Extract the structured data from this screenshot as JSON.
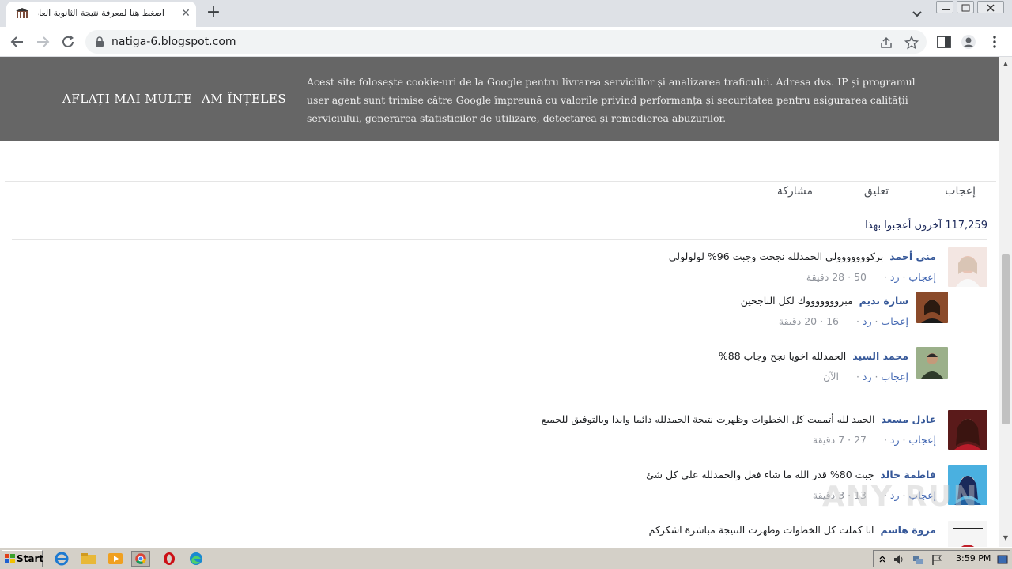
{
  "browser": {
    "tab_title": "اضغط هنا لمعرفة نتيجة الثانوية العامة",
    "tab_close": "✕",
    "new_tab": "+",
    "url": "natiga-6.blogspot.com"
  },
  "cookie_bar": {
    "learn_more": "AFLAȚI MAI MULTE",
    "understood": "AM ÎNȚELES",
    "text": "Acest site folosește cookie-uri de la Google pentru livrarea serviciilor și analizarea traficului. Adresa dvs. IP și programul user agent sunt trimise către Google împreună cu valorile privind performanța și securitatea pentru asigurarea calității serviciului, generarea statisticilor de utilizare, detectarea și remedierea abuzurilor."
  },
  "post_actions": {
    "like": "إعجاب",
    "comment": "تعليق",
    "share": "مشاركة"
  },
  "likes_summary": "117,259 آخرون أعجبوا بهذا",
  "comments": [
    {
      "name": "منى أحمد",
      "text": "بركووووووولى الحمدلله نجحت وجبت 96% لولولولى",
      "like": "إعجاب",
      "reply": "رد",
      "count": "50",
      "time": "28 دقيقة",
      "reply_level": 0
    },
    {
      "name": "سارة نديم",
      "text": "مبروووووووك لكل الناجحين",
      "like": "إعجاب",
      "reply": "رد",
      "count": "16",
      "time": "20 دقيقة",
      "reply_level": 1
    },
    {
      "name": "محمد السيد",
      "text": "الحمدلله اخويا نجح وجاب 88%",
      "like": "إعجاب",
      "reply": "رد",
      "count": "",
      "time": "الآن",
      "reply_level": 1
    },
    {
      "name": "عادل مسعد",
      "text": "الحمد لله أتممت كل الخطوات وظهرت نتيجة الحمدلله دائما وابدا وبالتوفيق للجميع",
      "like": "إعجاب",
      "reply": "رد",
      "count": "27",
      "time": "7 دقيقة",
      "reply_level": 0
    },
    {
      "name": "فاطمة خالد",
      "text": "جبت 80% قدر الله ما شاء فعل والحمدلله على كل شئ",
      "like": "إعجاب",
      "reply": "رد",
      "count": "13",
      "time": "3 دقيقة",
      "reply_level": 0
    },
    {
      "name": "مروة هاشم",
      "text": "انا كملت كل الخطوات وظهرت النتيجة مباشرة اشكركم",
      "like": "",
      "reply": "",
      "count": "",
      "time": "",
      "reply_level": 0
    }
  ],
  "watermark": "ANY RUN",
  "taskbar": {
    "start": "Start",
    "clock": "3:59 PM"
  }
}
